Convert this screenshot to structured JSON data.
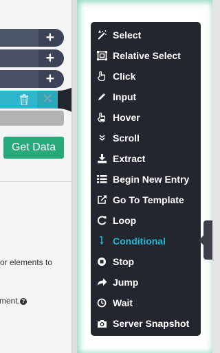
{
  "left_panel": {
    "get_data_label": "Get Data",
    "hint_text_1": "or elements to",
    "hint_text_2": "ment.",
    "help_glyph": "?"
  },
  "command_rows": [
    {
      "action_glyph": "+"
    },
    {
      "action_glyph": "+"
    },
    {
      "action_glyph": "+"
    }
  ],
  "selected_command": {
    "close_glyph": "✕",
    "accent": "#2fb6cd"
  },
  "menu": {
    "items": [
      {
        "label": "Select",
        "icon": "magic-wand-icon"
      },
      {
        "label": "Relative Select",
        "icon": "relative-select-icon"
      },
      {
        "label": "Click",
        "icon": "hand-pointer-icon"
      },
      {
        "label": "Input",
        "icon": "pencil-icon"
      },
      {
        "label": "Hover",
        "icon": "hand-hover-icon"
      },
      {
        "label": "Scroll",
        "icon": "double-chevron-down-icon"
      },
      {
        "label": "Extract",
        "icon": "download-icon"
      },
      {
        "label": "Begin New Entry",
        "icon": "list-icon"
      },
      {
        "label": "Go To Template",
        "icon": "external-link-icon"
      },
      {
        "label": "Loop",
        "icon": "refresh-icon"
      },
      {
        "label": "Conditional",
        "icon": "level-down-arrow-icon",
        "active": true
      },
      {
        "label": "Stop",
        "icon": "stop-circle-icon"
      },
      {
        "label": "Jump",
        "icon": "share-arrow-icon"
      },
      {
        "label": "Wait",
        "icon": "clock-icon"
      },
      {
        "label": "Server Snapshot",
        "icon": "camera-icon"
      }
    ]
  },
  "colors": {
    "menu_bg": "#23252f",
    "active": "#22b8d0",
    "get_data_bg": "#28a97a",
    "row_bg": "#3d4357"
  }
}
